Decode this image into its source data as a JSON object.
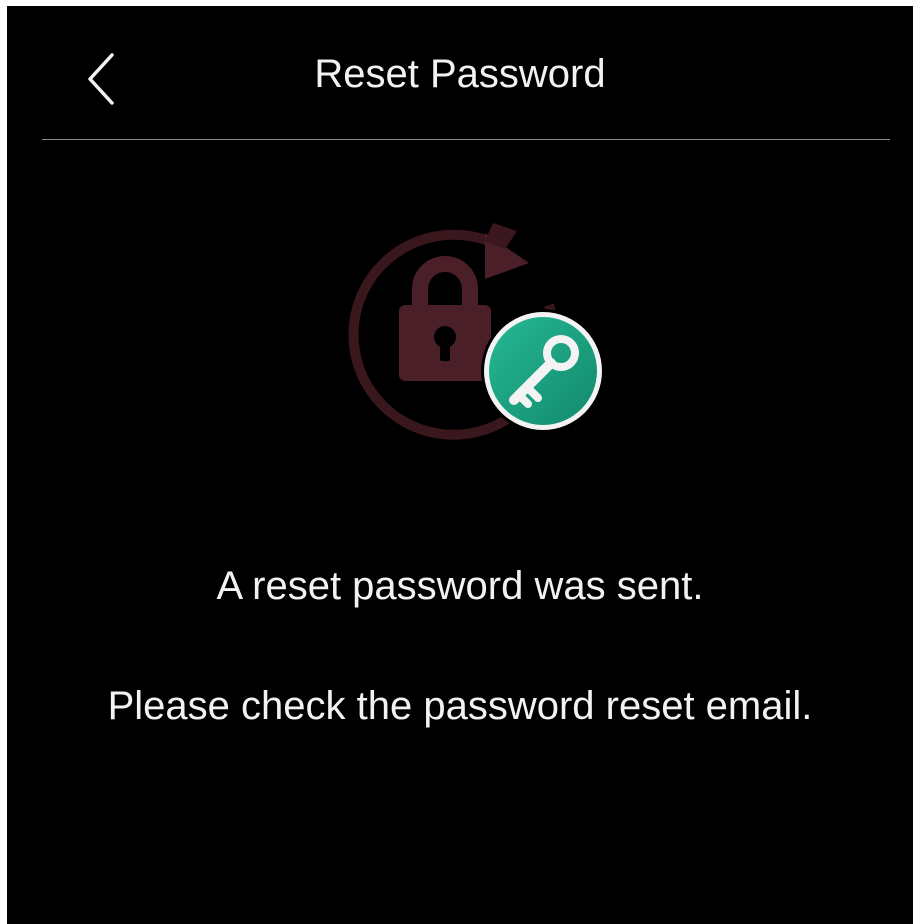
{
  "header": {
    "title": "Reset Password",
    "back_icon": "chevron-left-icon"
  },
  "illustration": {
    "lock_icon": "lock-icon",
    "refresh_icon": "refresh-arrow-icon",
    "key_icon": "key-icon",
    "accent_color": "#1aa383",
    "lock_color": "#4a1f27"
  },
  "messages": {
    "primary": "A reset password was sent.",
    "secondary": "Please check the password reset email."
  }
}
